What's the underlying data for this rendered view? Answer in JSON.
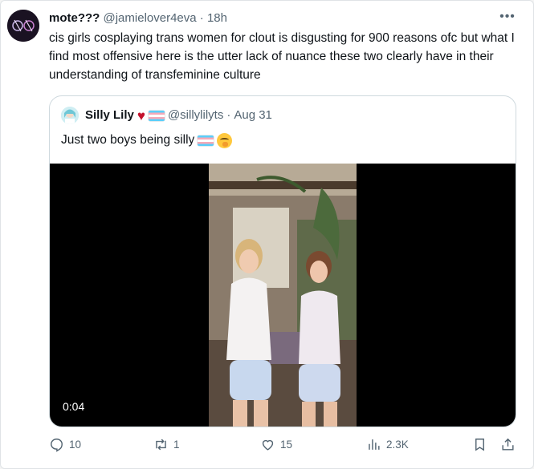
{
  "tweet": {
    "display_name": "mote???",
    "handle": "@jamielover4eva",
    "time": "18h",
    "text": "cis girls cosplaying trans women for clout is disgusting for 900 reasons ofc but what I find most offensive here is the utter lack of nuance these two clearly have in their understanding of transfeminine culture"
  },
  "quote": {
    "display_name": "Silly Lily",
    "handle": "@sillylilyts",
    "date": "Aug 31",
    "text": "Just two boys being silly",
    "video_time": "0:04"
  },
  "actions": {
    "replies": "10",
    "retweets": "1",
    "likes": "15",
    "views": "2.3K"
  },
  "icons": [
    "more-icon",
    "reply-icon",
    "retweet-icon",
    "like-icon",
    "views-icon",
    "bookmark-icon",
    "share-icon",
    "heart-emoji",
    "trans-flag-emoji",
    "face-emoji"
  ],
  "colors": {
    "text": "#0f1419",
    "secondary": "#536471",
    "border": "#cfd9de",
    "heart": "#c4122d"
  }
}
